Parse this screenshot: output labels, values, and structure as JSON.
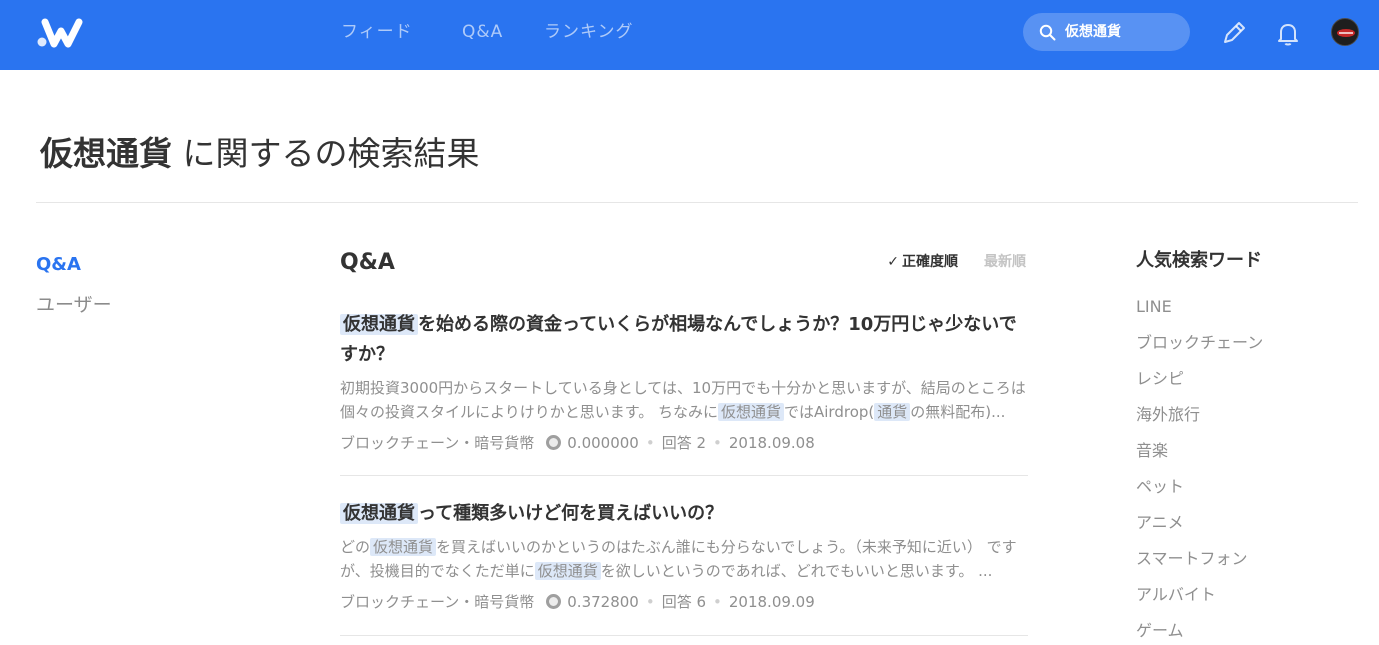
{
  "header": {
    "nav": [
      "フィード",
      "Q&A",
      "ランキング"
    ],
    "search_value": "仮想通貨",
    "icons": [
      "logo-icon",
      "search-icon",
      "pencil-icon",
      "bell-icon",
      "avatar"
    ]
  },
  "page": {
    "keyword": "仮想通貨",
    "title_rest": " に関するの検索結果"
  },
  "sidebar": {
    "items": [
      {
        "label": "Q&A",
        "active": true
      },
      {
        "label": "ユーザー",
        "active": false
      }
    ]
  },
  "main": {
    "title": "Q&A",
    "sort": {
      "accuracy": "正確度順",
      "latest": "最新順"
    },
    "results": [
      {
        "title_hl": "仮想通貨",
        "title_rest": "を始める際の資金っていくらが相場なんでしょうか？10万円じゃ少ないですか？",
        "excerpt": [
          {
            "t": "初期投資3000円からスタートしている身としては、10万円でも十分かと思いますが、結局のところは個々の投資スタイルによりけりかと思います。 ちなみに"
          },
          {
            "t": "仮想通貨",
            "hl": true
          },
          {
            "t": "ではAirdrop("
          },
          {
            "t": "通貨",
            "hl": true
          },
          {
            "t": "の無料配布)..."
          }
        ],
        "category": "ブロックチェーン・暗号貨幣",
        "coin": "0.000000",
        "answers": "回答 2",
        "date": "2018.09.08"
      },
      {
        "title_hl": "仮想通貨",
        "title_rest": "って種類多いけど何を買えばいいの？",
        "excerpt": [
          {
            "t": "どの"
          },
          {
            "t": "仮想通貨",
            "hl": true
          },
          {
            "t": "を買えばいいのかというのはたぶん誰にも分らないでしょう。（未来予知に近い） ですが、投機目的でなくただ単に"
          },
          {
            "t": "仮想通貨",
            "hl": true
          },
          {
            "t": "を欲しいというのであれば、どれでもいいと思います。 ..."
          }
        ],
        "category": "ブロックチェーン・暗号貨幣",
        "coin": "0.372800",
        "answers": "回答 6",
        "date": "2018.09.09"
      }
    ]
  },
  "popular": {
    "title": "人気検索ワード",
    "words": [
      "LINE",
      "ブロックチェーン",
      "レシピ",
      "海外旅行",
      "音楽",
      "ペット",
      "アニメ",
      "スマートフォン",
      "アルバイト",
      "ゲーム"
    ]
  },
  "colors": {
    "brand": "#2a74f0",
    "highlight": "#dde8f8",
    "muted_text": "#8f8f8f"
  }
}
